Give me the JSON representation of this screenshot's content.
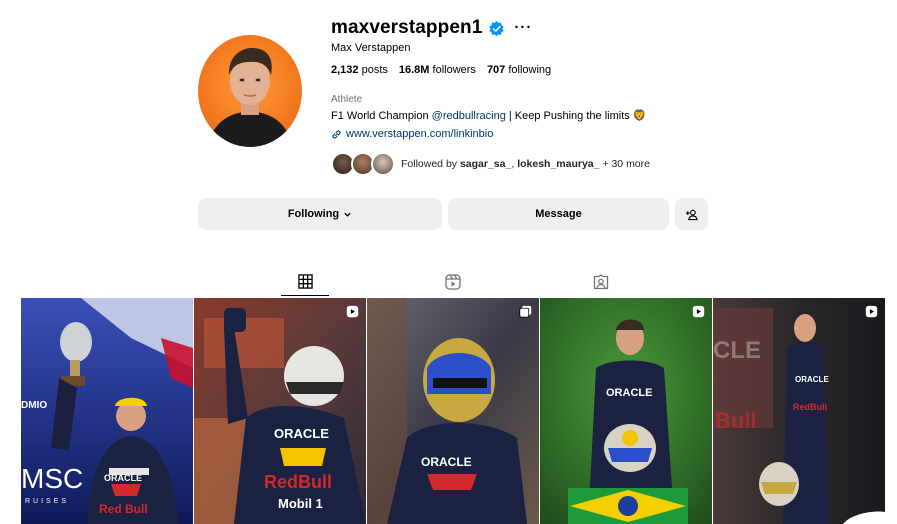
{
  "profile": {
    "username": "maxverstappen1",
    "full_name": "Max Verstappen",
    "verified": true,
    "stats": {
      "posts": "2,132",
      "posts_label": "posts",
      "followers": "16.8M",
      "followers_label": "followers",
      "following": "707",
      "following_label": "following"
    },
    "category": "Athlete",
    "bio_prefix": "F1 World Champion ",
    "bio_mention": "@redbullracing",
    "bio_suffix": " | Keep Pushing the limits ",
    "bio_emoji": "🦁",
    "link": "www.verstappen.com/linkinbio",
    "followed_by_prefix": "Followed by ",
    "followed_by_user1": "sagar_sa_",
    "followed_by_sep": ", ",
    "followed_by_user2": "lokesh_maurya_",
    "followed_by_suffix": " + 30 more"
  },
  "actions": {
    "following_label": "Following",
    "message_label": "Message"
  },
  "tabs": [
    {
      "name": "posts",
      "icon": "grid-icon",
      "active": true
    },
    {
      "name": "reels",
      "icon": "reels-icon",
      "active": false
    },
    {
      "name": "tagged",
      "icon": "tagged-icon",
      "active": false
    }
  ],
  "posts": [
    {
      "type": "image",
      "badge": "none",
      "text_visible": "MSC CRUISES / ORACLE / Red Bull"
    },
    {
      "type": "reel",
      "badge": "reel-icon",
      "text_visible": "ORACLE / Red Bull / Mobil 1"
    },
    {
      "type": "carousel",
      "badge": "carousel-icon",
      "text_visible": "ORACLE"
    },
    {
      "type": "reel",
      "badge": "reel-icon",
      "text_visible": "ORACLE"
    },
    {
      "type": "reel",
      "badge": "reel-icon",
      "text_visible": "Red Bull"
    }
  ],
  "colors": {
    "verified_blue": "#0095f6",
    "link_blue": "#00376b",
    "button_gray": "#efefef",
    "avatar_orange": "#f47b20"
  }
}
